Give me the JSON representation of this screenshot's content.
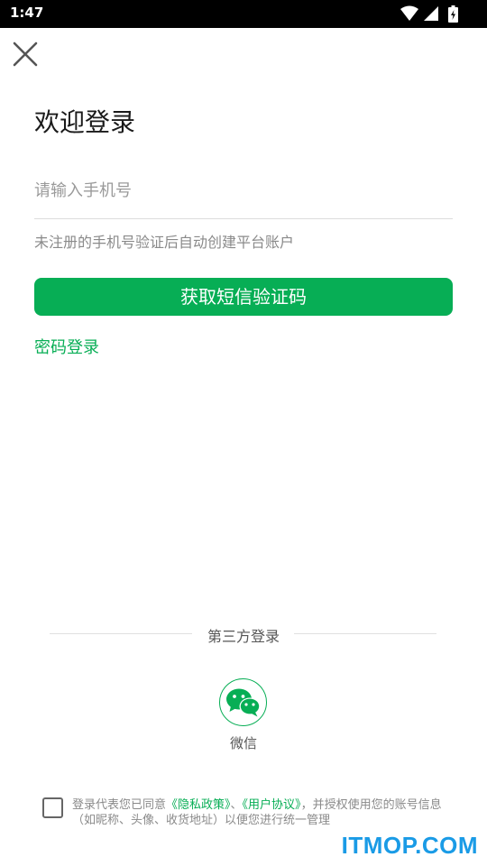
{
  "status_bar": {
    "time": "1:47"
  },
  "header": {
    "close_icon": "close-icon"
  },
  "login": {
    "title": "欢迎登录",
    "phone_placeholder": "请输入手机号",
    "hint": "未注册的手机号验证后自动创建平台账户",
    "sms_button": "获取短信验证码",
    "password_login": "密码登录"
  },
  "third_party": {
    "title": "第三方登录",
    "wechat_label": "微信",
    "wechat_icon": "wechat-icon"
  },
  "agreement": {
    "prefix": "登录代表您已同意",
    "privacy_link": "《隐私政策》",
    "separator": "、",
    "user_agreement_link": "《用户协议》",
    "suffix": "，并授权使用您的账号信息（如昵称、头像、收货地址）以便您进行统一管理"
  },
  "watermark": "ITMOP.COM",
  "colors": {
    "accent": "#07ae55",
    "status_bar": "#000000",
    "watermark": "#1a9be6"
  }
}
